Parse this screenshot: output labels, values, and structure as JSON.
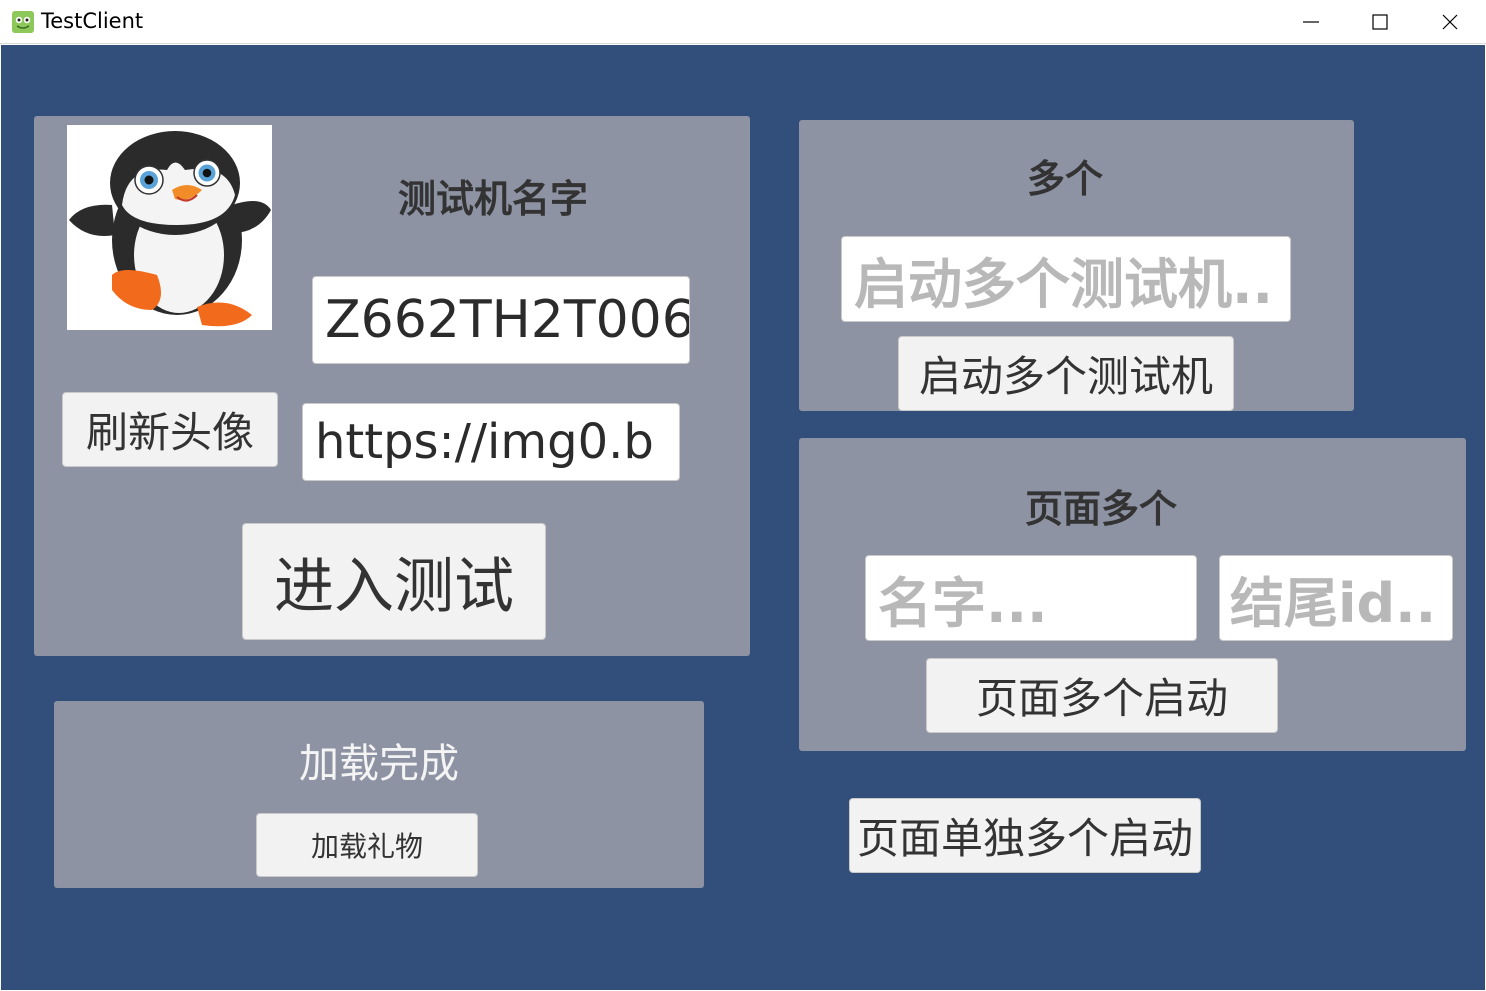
{
  "window": {
    "title": "TestClient",
    "icon": "frog-app-icon",
    "controls": [
      "minimize-icon",
      "maximize-icon",
      "close-icon"
    ]
  },
  "colors": {
    "background": "#324f7b",
    "panel": "#8e93a4",
    "button": "#f2f2f2",
    "input": "#ffffff",
    "placeholder": "#b8b8b8"
  },
  "left_panel": {
    "avatar": "penguin-avatar-image",
    "name_label": "测试机名字",
    "name_value": "Z662TH2T006",
    "refresh_avatar_label": "刷新头像",
    "url_value": "https://img0.b",
    "enter_test_label": "进入测试"
  },
  "load_panel": {
    "status_label": "加载完成",
    "load_gift_label": "加载礼物"
  },
  "multi_panel": {
    "title": "多个",
    "count_placeholder": "启动多个测试机..",
    "start_multi_label": "启动多个测试机"
  },
  "page_multi_panel": {
    "title": "页面多个",
    "name_placeholder": "名字...",
    "end_id_placeholder": "结尾id..",
    "page_start_label": "页面多个启动"
  },
  "page_single_multi_label": "页面单独多个启动"
}
